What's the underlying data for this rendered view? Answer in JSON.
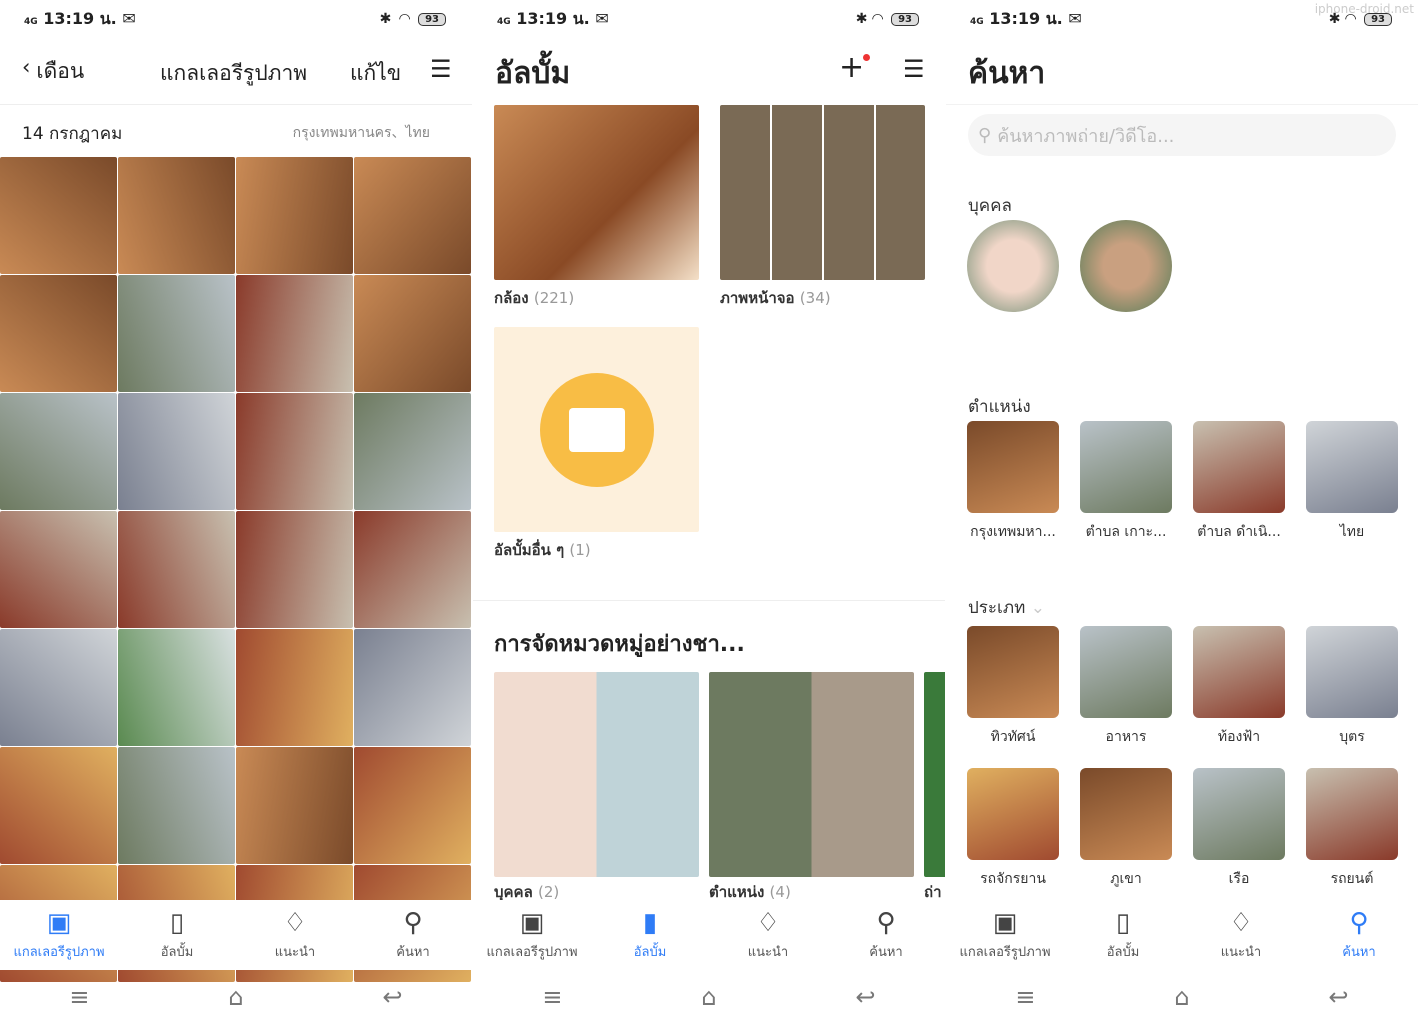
{
  "status": {
    "time": "13:19 น.",
    "network": "4G",
    "battery": "93"
  },
  "watermark": "iphone-droid.net",
  "tabs": [
    "แกลเลอรีรูปภาพ",
    "อัลบั้ม",
    "แนะนำ",
    "ค้นหา"
  ],
  "gallery": {
    "back_label": "เดือน",
    "title": "แกลเลอรีรูปภาพ",
    "edit_label": "แก้ไข",
    "date": "14 กรกฎาคม",
    "location": "กรุงเทพมหานคร、ไทย"
  },
  "albums": {
    "title": "อัลบั้ม",
    "items": [
      {
        "name": "กล้อง",
        "count": "(221)"
      },
      {
        "name": "ภาพหน้าจอ",
        "count": "(34)"
      },
      {
        "name": "อัลบั้มอื่น ๆ",
        "count": "(1)"
      }
    ],
    "smart_title": "การจัดหมวดหมู่อย่างชา...",
    "smart": [
      {
        "name": "บุคคล",
        "count": "(2)"
      },
      {
        "name": "ตำแหน่ง",
        "count": "(4)"
      },
      {
        "name": "ถ่า",
        "count": ""
      }
    ]
  },
  "search": {
    "title": "ค้นหา",
    "placeholder": "ค้นหาภาพถ่าย/วิดีโอ...",
    "people_label": "บุคคล",
    "places_label": "ตำแหน่ง",
    "places": [
      "กรุงเทพมหา...",
      "ตำบล เกาะ...",
      "ตำบล ดำเนิ...",
      "ไทย"
    ],
    "types_label": "ประเภท",
    "types": [
      "ทิวทัศน์",
      "อาหาร",
      "ท้องฟ้า",
      "บุตร",
      "รถจักรยาน",
      "ภูเขา",
      "เรือ",
      "รถยนต์"
    ]
  },
  "colors": {
    "accent": "#2f7cf6",
    "folder": "#f8bd45",
    "folder_bg": "#fdf0dc"
  }
}
